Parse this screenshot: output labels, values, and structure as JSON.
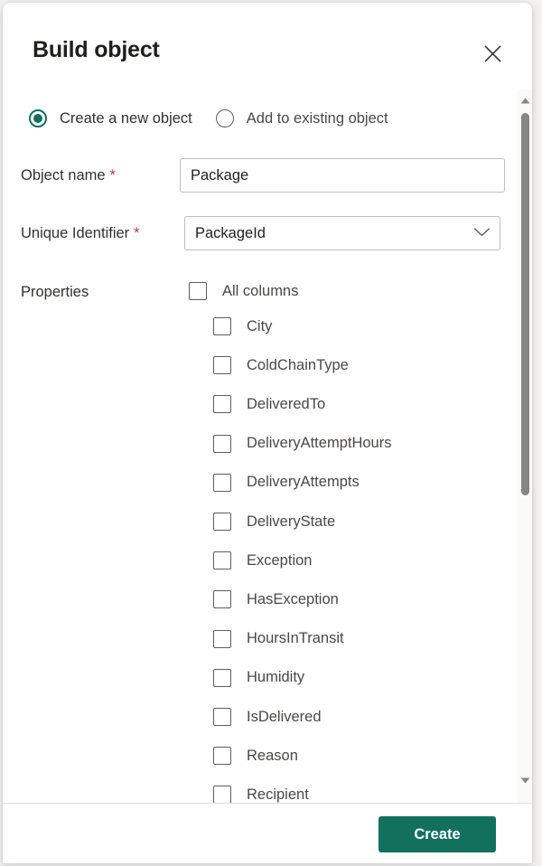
{
  "dialog": {
    "title": "Build object",
    "close_label": "Close"
  },
  "mode": {
    "options": [
      {
        "label": "Create a new object",
        "selected": true
      },
      {
        "label": "Add to existing object",
        "selected": false
      }
    ]
  },
  "form": {
    "object_name": {
      "label": "Object name",
      "required_marker": "*",
      "value": "Package",
      "placeholder": ""
    },
    "unique_identifier": {
      "label": "Unique Identifier",
      "required_marker": "*",
      "value": "PackageId"
    },
    "properties": {
      "label": "Properties",
      "all_columns": {
        "label": "All columns",
        "checked": false
      },
      "items": [
        {
          "label": "City",
          "checked": false
        },
        {
          "label": "ColdChainType",
          "checked": false
        },
        {
          "label": "DeliveredTo",
          "checked": false
        },
        {
          "label": "DeliveryAttemptHours",
          "checked": false
        },
        {
          "label": "DeliveryAttempts",
          "checked": false
        },
        {
          "label": "DeliveryState",
          "checked": false
        },
        {
          "label": "Exception",
          "checked": false
        },
        {
          "label": "HasException",
          "checked": false
        },
        {
          "label": "HoursInTransit",
          "checked": false
        },
        {
          "label": "Humidity",
          "checked": false
        },
        {
          "label": "IsDelivered",
          "checked": false
        },
        {
          "label": "Reason",
          "checked": false
        },
        {
          "label": "Recipient",
          "checked": false
        }
      ]
    }
  },
  "footer": {
    "create_label": "Create"
  },
  "colors": {
    "accent": "#12705c",
    "required": "#d13438",
    "text": "#323130",
    "muted_text": "#4a4847",
    "border": "#bfbebd",
    "scrollbar_thumb": "#868685"
  }
}
